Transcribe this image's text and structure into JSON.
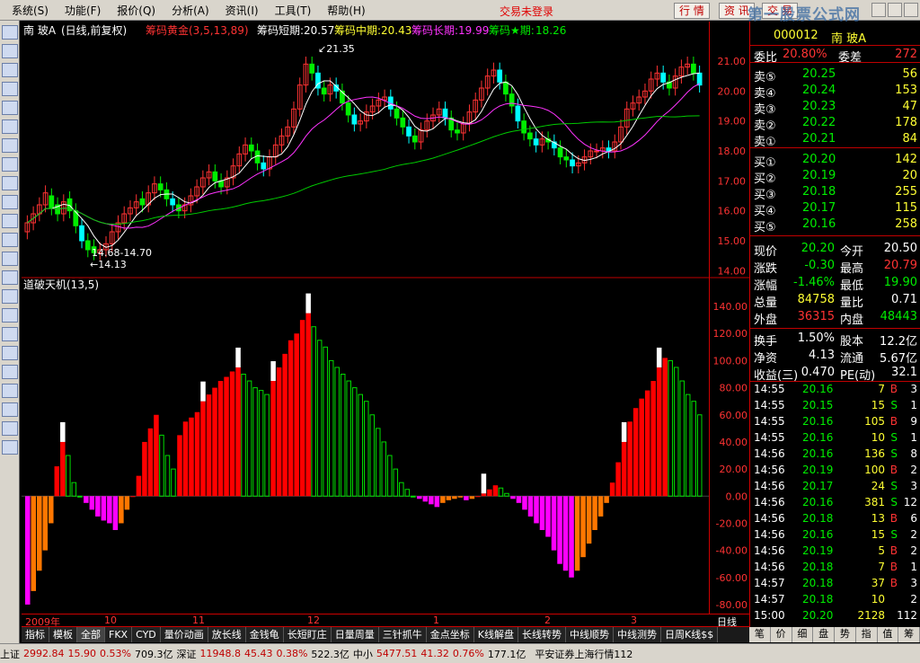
{
  "menu": {
    "items": [
      "系统(S)",
      "功能(F)",
      "报价(Q)",
      "分析(A)",
      "资讯(I)",
      "工具(T)",
      "帮助(H)"
    ],
    "login_status": "交易未登录",
    "btn_quote": "行 情",
    "btn_info": "资 讯",
    "btn_trade": "交 易",
    "logo": "第一股票公式网"
  },
  "stock_header": {
    "name": "南 玻A",
    "period": "(日线,前复权)",
    "indicator": "筹码黄金(3,5,13,89)",
    "short_label": "筹码短期:",
    "short_val": "20.57",
    "mid_label": "筹码中期:",
    "mid_val": "20.43",
    "long_label": "筹码长期:",
    "long_val": "19.99",
    "star_label": "筹码★期:",
    "star_val": "18.26"
  },
  "main_chart": {
    "y_ticks": [
      "21.00",
      "20.00",
      "19.00",
      "18.00",
      "17.00",
      "16.00",
      "15.00",
      "14.00"
    ],
    "high_label": "21.35",
    "low_label": "←14.13",
    "range_label": "14.68-14.70",
    "ylim": [
      13.8,
      21.6
    ]
  },
  "sub_chart": {
    "title": "道破天机(13,5)",
    "y_ticks": [
      "140.00",
      "120.00",
      "100.00",
      "80.00",
      "60.00",
      "40.00",
      "20.00",
      "0.00",
      "-20.00",
      "-40.00",
      "-60.00",
      "-80.00"
    ],
    "ylim": [
      -84,
      148
    ]
  },
  "date_axis": {
    "labels": [
      "2009年",
      "10",
      "11",
      "12",
      "1",
      "2",
      "3"
    ],
    "period": "日线"
  },
  "quote_panel": {
    "code": "000012",
    "name": "南 玻A",
    "weibi_label": "委比",
    "weibi": "20.80%",
    "weicha_label": "委差",
    "weicha": "272",
    "asks": [
      {
        "label": "卖⑤",
        "price": "20.25",
        "vol": "56"
      },
      {
        "label": "卖④",
        "price": "20.24",
        "vol": "153"
      },
      {
        "label": "卖③",
        "price": "20.23",
        "vol": "47"
      },
      {
        "label": "卖②",
        "price": "20.22",
        "vol": "178"
      },
      {
        "label": "卖①",
        "price": "20.21",
        "vol": "84"
      }
    ],
    "bids": [
      {
        "label": "买①",
        "price": "20.20",
        "vol": "142"
      },
      {
        "label": "买②",
        "price": "20.19",
        "vol": "20"
      },
      {
        "label": "买③",
        "price": "20.18",
        "vol": "255"
      },
      {
        "label": "买④",
        "price": "20.17",
        "vol": "115"
      },
      {
        "label": "买⑤",
        "price": "20.16",
        "vol": "258"
      }
    ],
    "stats": [
      {
        "l1": "现价",
        "v1": "20.20",
        "c1": "green",
        "l2": "今开",
        "v2": "20.50",
        "c2": "white"
      },
      {
        "l1": "涨跌",
        "v1": "-0.30",
        "c1": "green",
        "l2": "最高",
        "v2": "20.79",
        "c2": "red"
      },
      {
        "l1": "涨幅",
        "v1": "-1.46%",
        "c1": "green",
        "l2": "最低",
        "v2": "19.90",
        "c2": "green"
      },
      {
        "l1": "总量",
        "v1": "84758",
        "c1": "yel",
        "l2": "量比",
        "v2": "0.71",
        "c2": "white"
      },
      {
        "l1": "外盘",
        "v1": "36315",
        "c1": "red",
        "l2": "内盘",
        "v2": "48443",
        "c2": "green"
      },
      {
        "l1": "换手",
        "v1": "1.50%",
        "c1": "white",
        "l2": "股本",
        "v2": "12.2亿",
        "c2": "white"
      },
      {
        "l1": "净资",
        "v1": "4.13",
        "c1": "white",
        "l2": "流通",
        "v2": "5.67亿",
        "c2": "white"
      },
      {
        "l1": "收益(三)",
        "v1": "0.470",
        "c1": "white",
        "l2": "PE(动)",
        "v2": "32.1",
        "c2": "white"
      }
    ],
    "ticks": [
      {
        "t": "14:55",
        "p": "20.16",
        "v": "7",
        "d": "B",
        "n": "3",
        "pc": "green",
        "dc": "red"
      },
      {
        "t": "14:55",
        "p": "20.15",
        "v": "15",
        "d": "S",
        "n": "1",
        "pc": "green",
        "dc": "green"
      },
      {
        "t": "14:55",
        "p": "20.16",
        "v": "105",
        "d": "B",
        "n": "9",
        "pc": "green",
        "dc": "red"
      },
      {
        "t": "14:55",
        "p": "20.16",
        "v": "10",
        "d": "S",
        "n": "1",
        "pc": "green",
        "dc": "green"
      },
      {
        "t": "14:56",
        "p": "20.16",
        "v": "136",
        "d": "S",
        "n": "8",
        "pc": "green",
        "dc": "green"
      },
      {
        "t": "14:56",
        "p": "20.19",
        "v": "100",
        "d": "B",
        "n": "2",
        "pc": "green",
        "dc": "red"
      },
      {
        "t": "14:56",
        "p": "20.17",
        "v": "24",
        "d": "S",
        "n": "3",
        "pc": "green",
        "dc": "green"
      },
      {
        "t": "14:56",
        "p": "20.16",
        "v": "381",
        "d": "S",
        "n": "12",
        "pc": "green",
        "dc": "green"
      },
      {
        "t": "14:56",
        "p": "20.18",
        "v": "13",
        "d": "B",
        "n": "6",
        "pc": "green",
        "dc": "red"
      },
      {
        "t": "14:56",
        "p": "20.16",
        "v": "15",
        "d": "S",
        "n": "2",
        "pc": "green",
        "dc": "green"
      },
      {
        "t": "14:56",
        "p": "20.19",
        "v": "5",
        "d": "B",
        "n": "2",
        "pc": "green",
        "dc": "red"
      },
      {
        "t": "14:56",
        "p": "20.18",
        "v": "7",
        "d": "B",
        "n": "1",
        "pc": "green",
        "dc": "red"
      },
      {
        "t": "14:57",
        "p": "20.18",
        "v": "37",
        "d": "B",
        "n": "3",
        "pc": "green",
        "dc": "red"
      },
      {
        "t": "14:57",
        "p": "20.18",
        "v": "10",
        "d": "",
        "n": "2",
        "pc": "green",
        "dc": "white"
      },
      {
        "t": "15:00",
        "p": "20.20",
        "v": "2128",
        "d": "",
        "n": "112",
        "pc": "green",
        "dc": "white"
      }
    ],
    "tabs": [
      "笔",
      "价",
      "细",
      "盘",
      "势",
      "指",
      "值",
      "筹"
    ]
  },
  "bottom_tabs": [
    "指标",
    "模板",
    "全部",
    "FKX",
    "CYD",
    "量价动画",
    "放长线",
    "金钱龟",
    "长短盯庄",
    "日量周量",
    "三针抓牛",
    "金点坐标",
    "K线解盘",
    "长线转势",
    "中线顺势",
    "中线测势",
    "日周K线$$"
  ],
  "statusbar": {
    "sh_label": "上证",
    "sh_val": "2992.84",
    "sh_chg": "15.90",
    "sh_pct": "0.53%",
    "sh_amt": "709.3亿",
    "sz_label": "深证",
    "sz_val": "11948.8",
    "sz_chg": "45.43",
    "sz_pct": "0.38%",
    "sz_amt": "522.3亿",
    "zx_label": "中小",
    "zx_val": "5477.51",
    "zx_chg": "41.32",
    "zx_pct": "0.76%",
    "zx_amt": "177.1亿",
    "broker": "平安证券上海行情112"
  },
  "chart_data": [
    {
      "type": "candlestick",
      "title": "南 玻A (日线,前复权)",
      "ylim": [
        13.8,
        21.6
      ],
      "close": [
        15.6,
        15.9,
        16.2,
        16.6,
        16.1,
        15.9,
        16.3,
        16.0,
        15.5,
        15.0,
        14.7,
        14.6,
        14.7,
        14.9,
        15.3,
        15.6,
        15.9,
        16.1,
        16.3,
        16.2,
        16.6,
        16.9,
        16.7,
        16.4,
        16.2,
        16.0,
        16.2,
        16.5,
        16.8,
        17.1,
        17.3,
        17.0,
        16.8,
        17.1,
        17.5,
        17.9,
        18.2,
        18.0,
        17.6,
        17.4,
        17.8,
        18.2,
        18.5,
        18.8,
        19.4,
        20.2,
        20.9,
        20.6,
        20.1,
        19.9,
        20.2,
        20.0,
        19.6,
        19.2,
        18.9,
        19.0,
        19.3,
        19.5,
        19.7,
        19.8,
        19.4,
        19.1,
        18.8,
        18.5,
        18.3,
        18.7,
        19.0,
        19.2,
        19.4,
        19.1,
        18.7,
        18.6,
        18.9,
        19.3,
        19.7,
        20.1,
        20.5,
        20.7,
        20.3,
        19.9,
        19.5,
        19.0,
        18.6,
        18.4,
        18.2,
        18.4,
        18.3,
        18.1,
        17.8,
        17.7,
        17.5,
        17.6,
        17.8,
        18.0,
        18.0,
        18.1,
        18.0,
        18.3,
        18.8,
        19.4,
        19.6,
        19.8,
        20.0,
        20.4,
        20.6,
        20.3,
        20.1,
        20.5,
        20.8,
        20.9,
        20.6,
        20.2
      ],
      "open": [
        15.3,
        15.6,
        15.9,
        16.2,
        16.5,
        16.2,
        15.9,
        16.4,
        16.0,
        15.5,
        15.0,
        14.8,
        14.6,
        14.7,
        14.9,
        15.3,
        15.6,
        15.9,
        16.1,
        16.4,
        16.2,
        16.6,
        16.9,
        16.7,
        16.4,
        16.2,
        16.0,
        16.2,
        16.5,
        16.8,
        17.1,
        17.3,
        17.0,
        16.8,
        17.1,
        17.5,
        17.9,
        18.2,
        18.0,
        17.6,
        17.4,
        17.8,
        18.2,
        18.5,
        18.8,
        19.4,
        20.2,
        20.9,
        20.6,
        20.1,
        19.9,
        20.2,
        20.0,
        19.6,
        19.2,
        18.9,
        19.0,
        19.3,
        19.5,
        19.7,
        19.8,
        19.4,
        19.1,
        18.8,
        18.5,
        18.3,
        18.7,
        19.0,
        19.2,
        19.4,
        19.1,
        18.7,
        18.6,
        18.9,
        19.3,
        19.7,
        20.1,
        20.5,
        20.7,
        20.3,
        19.9,
        19.5,
        19.0,
        18.6,
        18.4,
        18.2,
        18.4,
        18.3,
        18.1,
        17.8,
        17.7,
        17.5,
        17.6,
        17.8,
        18.0,
        18.0,
        18.1,
        18.0,
        18.3,
        18.8,
        19.4,
        19.6,
        19.8,
        20.0,
        20.4,
        20.6,
        20.3,
        20.1,
        20.5,
        20.8,
        20.9,
        20.6
      ],
      "ma_lines": [
        "white",
        "purple",
        "green"
      ]
    },
    {
      "type": "bar",
      "title": "道破天机(13,5)",
      "ylim": [
        -84,
        148
      ],
      "values": [
        -80,
        -70,
        -55,
        -40,
        -20,
        22,
        40,
        30,
        10,
        0,
        -5,
        -10,
        -15,
        -18,
        -20,
        -25,
        -20,
        -10,
        0,
        15,
        40,
        50,
        60,
        45,
        30,
        20,
        45,
        55,
        58,
        62,
        70,
        75,
        80,
        85,
        88,
        92,
        95,
        90,
        85,
        80,
        78,
        75,
        85,
        95,
        105,
        115,
        120,
        130,
        135,
        125,
        115,
        110,
        100,
        95,
        90,
        85,
        80,
        75,
        70,
        60,
        50,
        40,
        30,
        20,
        10,
        5,
        0,
        -2,
        -4,
        -6,
        -8,
        -5,
        -3,
        -2,
        -1,
        -3,
        -2,
        0,
        2,
        5,
        8,
        6,
        2,
        -2,
        -5,
        -10,
        -15,
        -20,
        -25,
        -30,
        -40,
        -50,
        -55,
        -60,
        -55,
        -45,
        -35,
        -25,
        -15,
        -5,
        10,
        25,
        40,
        55,
        65,
        72,
        78,
        85,
        95,
        102,
        100,
        95,
        85,
        75,
        70,
        60
      ],
      "zero_line": 0
    }
  ]
}
